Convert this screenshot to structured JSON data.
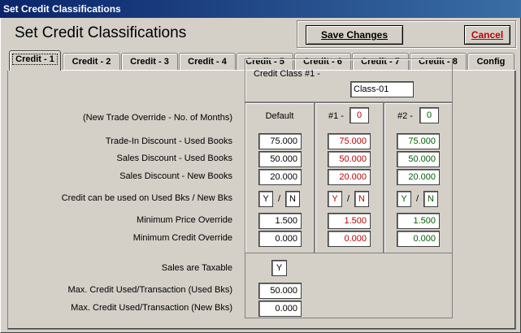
{
  "window": {
    "title": "Set Credit Classifications"
  },
  "header": {
    "title": "Set Credit Classifications",
    "save_label": "Save Changes",
    "cancel_label": "Cancel"
  },
  "tabs": [
    {
      "label": "Credit - 1"
    },
    {
      "label": "Credit - 2"
    },
    {
      "label": "Credit - 3"
    },
    {
      "label": "Credit - 4"
    },
    {
      "label": "Credit - 5"
    },
    {
      "label": "Credit - 6"
    },
    {
      "label": "Credit - 7"
    },
    {
      "label": "Credit - 8"
    },
    {
      "label": "Config"
    }
  ],
  "credit_class": {
    "label": "Credit Class #1  -",
    "value": "Class-01"
  },
  "columns": {
    "default_label": "Default",
    "c1_label": "#1 -",
    "c1_months": "0",
    "c2_label": "#2 -",
    "c2_months": "0"
  },
  "labels": {
    "override": "(New Trade Override - No. of Months)",
    "trade_in_used": "Trade-In Discount - Used Books",
    "sales_used": "Sales Discount - Used Books",
    "sales_new": "Sales Discount - New Books",
    "credit_used": "Credit can be used on Used Bks / New Bks",
    "min_price": "Minimum Price Override",
    "min_credit": "Minimum Credit Override",
    "taxable": "Sales are Taxable",
    "max_used": "Max. Credit Used/Transaction (Used Bks)",
    "max_new": "Max. Credit Used/Transaction (New Bks)"
  },
  "values": {
    "default": {
      "trade_in_used": "75.000",
      "sales_used": "50.000",
      "sales_new": "20.000",
      "used_flag": "Y",
      "new_flag": "N",
      "min_price": "1.500",
      "min_credit": "0.000"
    },
    "c1": {
      "trade_in_used": "75.000",
      "sales_used": "50.000",
      "sales_new": "20.000",
      "used_flag": "Y",
      "new_flag": "N",
      "min_price": "1.500",
      "min_credit": "0.000"
    },
    "c2": {
      "trade_in_used": "75.000",
      "sales_used": "50.000",
      "sales_new": "20.000",
      "used_flag": "Y",
      "new_flag": "N",
      "min_price": "1.500",
      "min_credit": "0.000"
    },
    "taxable": "Y",
    "max_used": "50.000",
    "max_new": "0.000"
  },
  "slash": "/",
  "colors": {
    "red_value": "#c00000",
    "green_value": "#006000",
    "title_bar": "#0a246a"
  }
}
